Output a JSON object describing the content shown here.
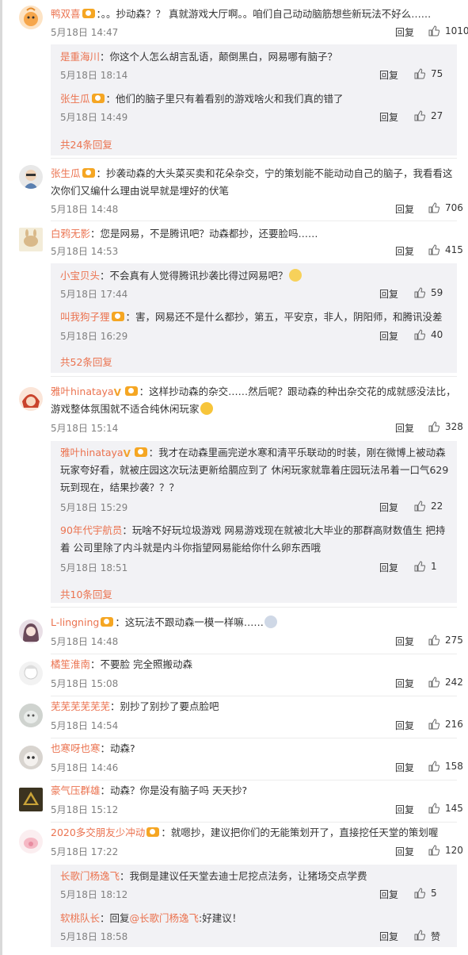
{
  "common": {
    "reply_label": "回复"
  },
  "comments": [
    {
      "user": "鸭双喜",
      "text": "：。。抄动森？？ 真就游戏大厅啊。。咱们自己动动脑筋想些新玩法不好么……",
      "time": "5月18日 14:47",
      "likes": "1010",
      "replies": [
        {
          "user": "是重海川",
          "text": "：你这个人怎么胡言乱语，颠倒黑白，网易哪有脑子？",
          "time": "5月18日 18:14",
          "likes": "75"
        },
        {
          "user": "张生瓜",
          "text": "：他们的脑子里只有着看别的游戏啥火和我们真的错了",
          "time": "5月18日 14:49",
          "likes": "27"
        }
      ],
      "more": "共24条回复"
    },
    {
      "user": "张生瓜",
      "text": "：抄袭动森的大头菜买卖和花朵杂交，宁的策划能不能动动自己的脑子，我看看这次你们又编什么理由说早就是埋好的伏笔",
      "time": "5月18日 14:48",
      "likes": "706"
    },
    {
      "user": "白鸦无影",
      "text": "：您是网易，不是腾讯吧？动森都抄，还要脸吗……",
      "time": "5月18日 14:53",
      "likes": "415",
      "replies": [
        {
          "user": "小宝贝头",
          "text": "：不会真有人觉得腾讯抄袭比得过网易吧？",
          "time": "5月18日 17:44",
          "likes": "59"
        },
        {
          "user": "叫我狗子狸",
          "text": "：害，网易还不是什么都抄，第五，平安京，非人，阴阳师，和腾讯没差",
          "time": "5月18日 16:29",
          "likes": "40"
        }
      ],
      "more": "共52条回复"
    },
    {
      "user": "雅叶hinataya",
      "text": "：这样抄动森的杂交……然后呢？跟动森的种出杂交花的成就感没法比，游戏整体氛围就不适合纯休闲玩家",
      "time": "5月18日 15:14",
      "likes": "328",
      "replies": [
        {
          "user": "雅叶hinataya",
          "text": "：我才在动森里画完逆水寒和清平乐联动的时装，刚在微博上被动森玩家夸好看，就被庄园这次玩法更新给膈应到了 休闲玩家就靠着庄园玩法吊着一口气629玩到现在，结果抄袭？？？",
          "time": "5月18日 15:29",
          "likes": "22"
        },
        {
          "user": "90年代宇航员",
          "text": "：玩啥不好玩垃圾游戏 网易游戏现在就被北大毕业的那群高财数值生 把持着 公司里除了内斗就是内斗你指望网易能给你什么卵东西哦",
          "time": "5月18日 18:51",
          "likes": "1"
        }
      ],
      "more": "共10条回复"
    },
    {
      "user": "L-lingning",
      "text": "：这玩法不跟动森一模一样嘛……",
      "time": "5月18日 14:48",
      "likes": "275"
    },
    {
      "user": "橘笙淮南",
      "text": "：不要脸 完全照搬动森",
      "time": "5月18日 15:08",
      "likes": "242"
    },
    {
      "user": "芜芜芜芜芜芜",
      "text": "：别抄了别抄了要点脸吧",
      "time": "5月18日 14:54",
      "likes": "216"
    },
    {
      "user": "也寒呀也寒",
      "text": "：动森?",
      "time": "5月18日 14:46",
      "likes": "158"
    },
    {
      "user": "豪气压群雄",
      "text": "：动森？你是没有脑子吗 天天抄?",
      "time": "5月18日 15:12",
      "likes": "145"
    },
    {
      "user": "2020多交朋友少冲动",
      "text": "：就嗯抄，建议把你们的无能策划开了，直接挖任天堂的策划喔",
      "time": "5月18日 17:22",
      "likes": "120",
      "replies": [
        {
          "user": "长歌门杨逸飞",
          "text": "：我倒是建议任天堂去迪士尼挖点法务，让猪场交点学费",
          "time": "5月18日 18:12",
          "likes": "5"
        },
        {
          "user": "软桃队长",
          "text": "：回复",
          "mention": "@长歌门杨逸飞",
          "text2": ":好建议！",
          "time": "5月18日 18:58",
          "likes": "赞"
        }
      ]
    }
  ],
  "colors": {
    "username": "#eb7350",
    "reply_bg": "#f2f2f5",
    "time": "#808080",
    "badge": "#f5a623"
  }
}
